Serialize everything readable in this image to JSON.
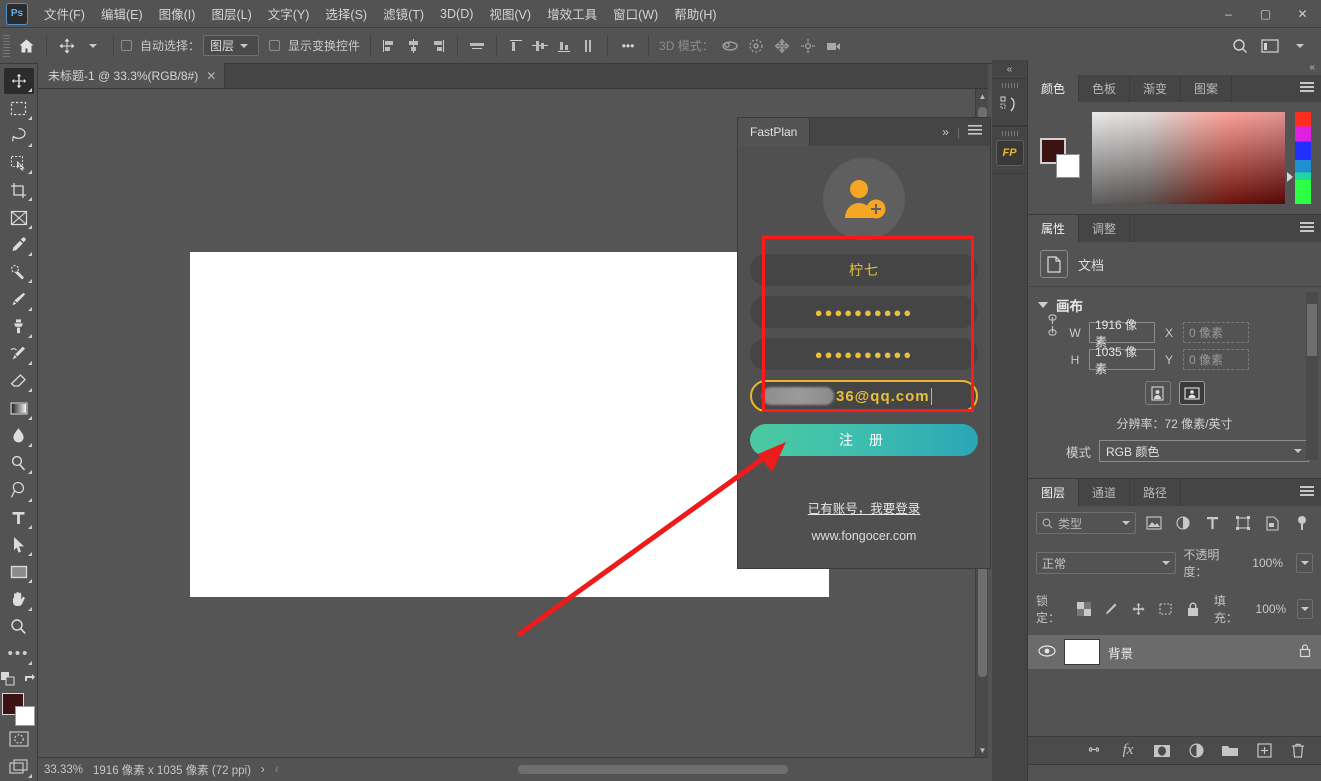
{
  "window": {
    "app_logo": "Ps",
    "minimize": "–",
    "maximize": "▢",
    "close": "✕"
  },
  "menubar": {
    "items": [
      {
        "label": "文件(F)"
      },
      {
        "label": "编辑(E)"
      },
      {
        "label": "图像(I)"
      },
      {
        "label": "图层(L)"
      },
      {
        "label": "文字(Y)"
      },
      {
        "label": "选择(S)"
      },
      {
        "label": "滤镜(T)"
      },
      {
        "label": "3D(D)"
      },
      {
        "label": "视图(V)"
      },
      {
        "label": "增效工具"
      },
      {
        "label": "窗口(W)"
      },
      {
        "label": "帮助(H)"
      }
    ]
  },
  "options_bar": {
    "home_icon": "home-icon",
    "move_tool_icon": "move-tool-icon",
    "auto_select_label": "自动选择：",
    "auto_select_value": "图层",
    "show_transform_label": "显示变换控件",
    "more_label": "•••",
    "mode3d_label": "3D 模式：",
    "search_icon": "search-icon",
    "workspace_icon": "workspace-icon"
  },
  "toolbar": {
    "tools": [
      {
        "name": "move-tool",
        "glyph": "✥"
      },
      {
        "name": "marquee-tool",
        "glyph": "▭"
      },
      {
        "name": "lasso-tool",
        "glyph": "◯"
      },
      {
        "name": "quick-selection-tool",
        "glyph": "▧"
      },
      {
        "name": "crop-tool",
        "glyph": "⌗"
      },
      {
        "name": "frame-tool",
        "glyph": "⊠"
      },
      {
        "name": "eyedropper-tool",
        "glyph": "✎"
      },
      {
        "name": "healing-brush-tool",
        "glyph": "⟋"
      },
      {
        "name": "brush-tool",
        "glyph": "🖌"
      },
      {
        "name": "clone-stamp-tool",
        "glyph": "⎍"
      },
      {
        "name": "history-brush-tool",
        "glyph": "⌇"
      },
      {
        "name": "eraser-tool",
        "glyph": "◹"
      },
      {
        "name": "gradient-tool",
        "glyph": "▤"
      },
      {
        "name": "blur-tool",
        "glyph": "💧"
      },
      {
        "name": "dodge-tool",
        "glyph": "🔍"
      },
      {
        "name": "pen-tool",
        "glyph": "✒"
      },
      {
        "name": "type-tool",
        "glyph": "T"
      },
      {
        "name": "path-selection-tool",
        "glyph": "➤"
      },
      {
        "name": "rectangle-tool",
        "glyph": "▭"
      },
      {
        "name": "hand-tool",
        "glyph": "✋"
      },
      {
        "name": "zoom-tool",
        "glyph": "🔎"
      },
      {
        "name": "edit-toolbar",
        "glyph": "•••"
      }
    ],
    "foreground_color": "#3d1212",
    "background_color": "#ffffff",
    "quick_mask_icon": "quick-mask-icon",
    "screen_mode_icon": "screen-mode-icon"
  },
  "document": {
    "tab_label": "未标题-1 @ 33.3%(RGB/8#)",
    "tab_close": "✕"
  },
  "status_bar": {
    "zoom": "33.33%",
    "dimensions": "1916 像素 x 1035 像素 (72 ppi)",
    "expand_arrow": "›",
    "collapse_arrow": "‹"
  },
  "fastplan": {
    "tab_label": "FastPlan",
    "collapse_icon": "»",
    "menu_icon": "panel-menu-icon",
    "avatar_icon": "add-user-avatar-icon",
    "username_value": "柠七",
    "password_value": "●●●●●●●●●●",
    "confirm_password_value": "●●●●●●●●●●",
    "email_value": "36@qq.com",
    "email_redacted": "redacted-email-prefix",
    "submit_label": "注 册",
    "login_link": "已有账号，我要登录",
    "site": "www.fongocer.com",
    "highlight_color": "#ff1a1a",
    "email_border_color": "#f0b429",
    "text_color": "#e8c03a"
  },
  "icon_rail": {
    "collapse_icon": "«",
    "buttons": [
      {
        "name": "actions-history-icon",
        "label": ""
      },
      {
        "name": "fastplan-icon",
        "label": "FP"
      }
    ]
  },
  "right_dock": {
    "collapse_icon": "«"
  },
  "color_panel": {
    "tabs": [
      {
        "label": "颜色",
        "active": true
      },
      {
        "label": "色板",
        "active": false
      },
      {
        "label": "渐变",
        "active": false
      },
      {
        "label": "图案",
        "active": false
      }
    ],
    "menu_icon": "panel-menu-icon",
    "foreground_color": "#3d1212",
    "background_color": "#ffffff",
    "spectrum_name": "color-spectrum",
    "hue_slider_name": "hue-slider"
  },
  "properties_panel": {
    "tabs": [
      {
        "label": "属性",
        "active": true
      },
      {
        "label": "调整",
        "active": false
      }
    ],
    "menu_icon": "panel-menu-icon",
    "doc_icon": "document-icon",
    "doc_label": "文档",
    "section_title": "画布",
    "w_label": "W",
    "w_value": "1916 像素",
    "x_label": "X",
    "x_value": "0 像素",
    "h_label": "H",
    "h_value": "1035 像素",
    "y_label": "Y",
    "y_value": "0 像素",
    "link_icon": "link-dimensions-icon",
    "portrait_icon": "portrait-orientation-icon",
    "landscape_icon": "landscape-orientation-icon",
    "resolution_label": "分辨率：72 像素/英寸",
    "mode_label": "模式",
    "mode_value": "RGB 颜色"
  },
  "layers_panel": {
    "tabs": [
      {
        "label": "图层",
        "active": true
      },
      {
        "label": "通道",
        "active": false
      },
      {
        "label": "路径",
        "active": false
      }
    ],
    "menu_icon": "panel-menu-icon",
    "filter_label": "类型",
    "filter_icons": [
      "pixel-filter-icon",
      "adjustment-filter-icon",
      "type-filter-icon",
      "shape-filter-icon",
      "smart-object-filter-icon",
      "filter-toggle-icon"
    ],
    "blend_mode": "正常",
    "opacity_label": "不透明度：",
    "opacity_value": "100%",
    "lock_label": "锁定：",
    "lock_icons": [
      "lock-transparency-icon",
      "lock-image-icon",
      "lock-position-icon",
      "lock-artboard-icon",
      "lock-all-icon"
    ],
    "fill_label": "填充：",
    "fill_value": "100%",
    "layers": [
      {
        "name": "背景",
        "visible": true,
        "locked": true,
        "thumb_color": "#ffffff"
      }
    ],
    "footer_icons": [
      {
        "name": "link-layers-icon",
        "glyph": "⛓"
      },
      {
        "name": "layer-style-icon",
        "glyph": "fx"
      },
      {
        "name": "layer-mask-icon",
        "glyph": "◑"
      },
      {
        "name": "adjustment-layer-icon",
        "glyph": "◕"
      },
      {
        "name": "new-group-icon",
        "glyph": "🗀"
      },
      {
        "name": "new-layer-icon",
        "glyph": "⊞"
      },
      {
        "name": "delete-layer-icon",
        "glyph": "🗑"
      }
    ]
  },
  "annotation": {
    "arrow_name": "red-pointer-arrow",
    "arrow_color": "#ee1b1b"
  }
}
